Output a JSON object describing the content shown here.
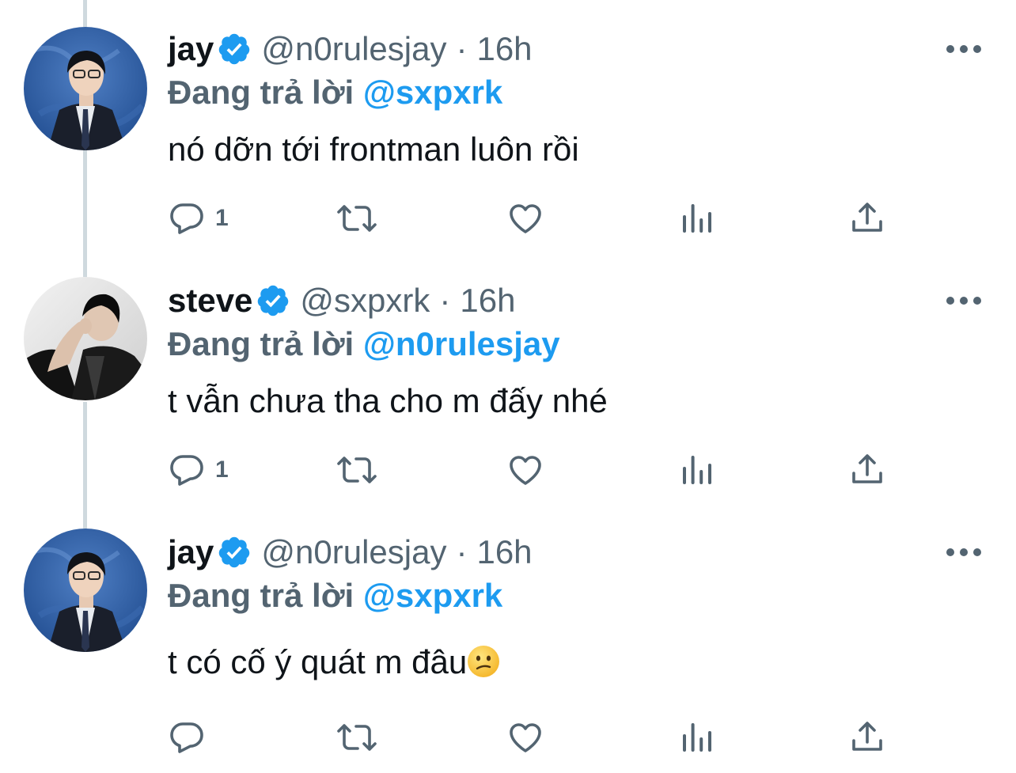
{
  "tweets": [
    {
      "display_name": "jay",
      "handle": "@n0rulesjay",
      "separator": "·",
      "time": "16h",
      "replying_prefix": "Đang trả lời",
      "replying_to": "@sxpxrk",
      "text": "nó dỡn tới frontman luôn rồi",
      "reply_count": "1",
      "avatar": "jay-avatar"
    },
    {
      "display_name": "steve",
      "handle": "@sxpxrk",
      "separator": "·",
      "time": "16h",
      "replying_prefix": "Đang trả lời",
      "replying_to": "@n0rulesjay",
      "text": "t vẫn chưa tha cho m đấy nhé",
      "reply_count": "1",
      "avatar": "steve-avatar"
    },
    {
      "display_name": "jay",
      "handle": "@n0rulesjay",
      "separator": "·",
      "time": "16h",
      "replying_prefix": "Đang trả lời",
      "replying_to": "@sxpxrk",
      "text": "t có cố ý quát m đâu",
      "text_emoji": "confused-face-emoji",
      "reply_count": "",
      "avatar": "jay-avatar"
    }
  ],
  "icons": {
    "reply": "reply-icon",
    "retweet": "retweet-icon",
    "like": "heart-icon",
    "views": "views-icon",
    "share": "share-icon",
    "more": "more-icon",
    "verified": "verified-badge-icon"
  },
  "colors": {
    "accent": "#1d9bf0",
    "secondary_text": "#536471",
    "primary_text": "#0f1419",
    "thread_line": "#cfd9de"
  }
}
